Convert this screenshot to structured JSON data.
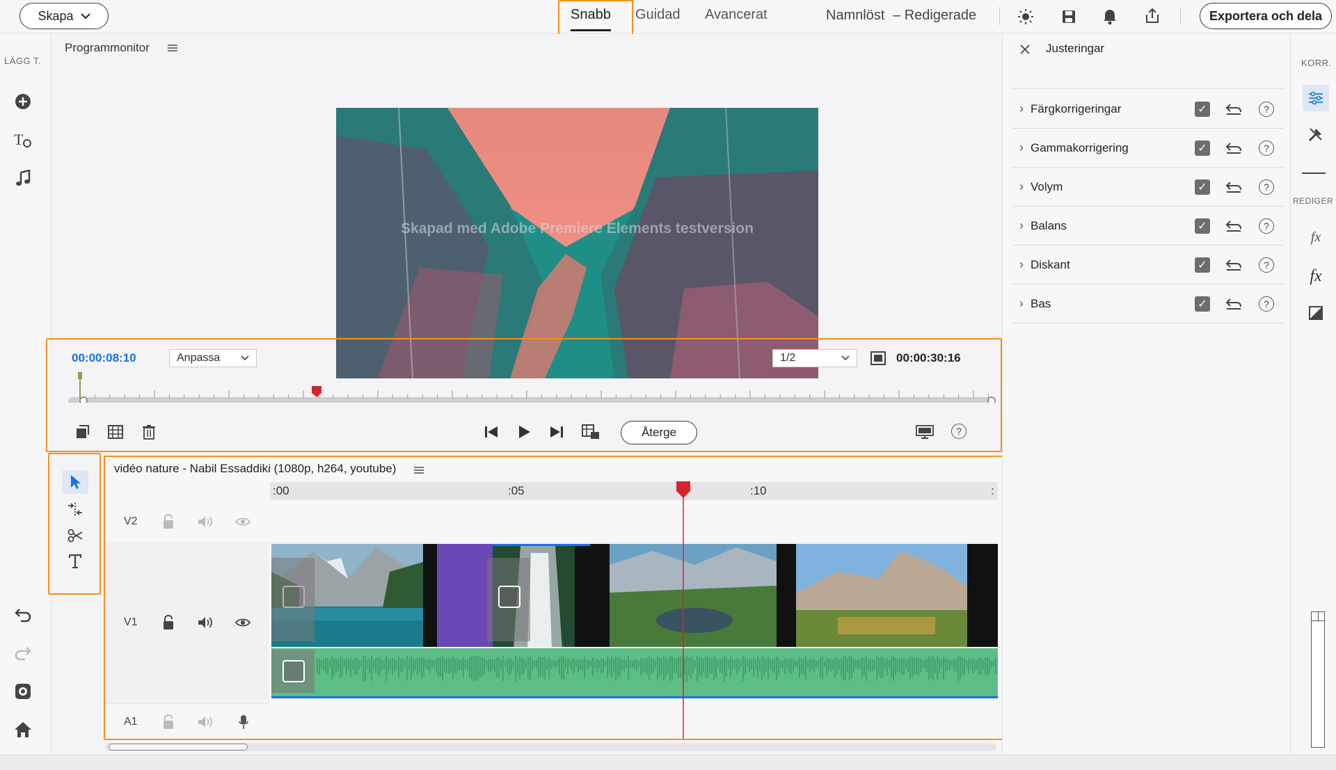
{
  "topbar": {
    "create_label": "Skapa",
    "modes": [
      "Snabb",
      "Guidad",
      "Avancerat"
    ],
    "active_mode": "Snabb",
    "project_name": "Namnlöst",
    "project_status": "– Redigerade",
    "export_label": "Exportera och dela",
    "icons": [
      "brightness-icon",
      "save-icon",
      "bell-icon",
      "share-icon"
    ]
  },
  "leftbar": {
    "add_label": "LÄGG T.",
    "tools": [
      "add-media-icon",
      "title-icon",
      "music-icon"
    ],
    "bottom": [
      "undo-icon",
      "redo-icon",
      "organizer-icon",
      "home-icon"
    ]
  },
  "monitor": {
    "title": "Programmonitor",
    "watermark": "Skapad med Adobe Premiere Elements testversion",
    "current_time": "00:00:08:10",
    "fit_option": "Anpassa",
    "resolution": "1/2",
    "duration": "00:00:30:16",
    "render_label": "Återge",
    "accent_time_color": "#1473e6"
  },
  "timeline": {
    "clip_name": "vidéo nature - Nabil Essaddiki (1080p, h264, youtube)",
    "ruler": [
      ":00",
      ":05",
      ":10",
      ":"
    ],
    "tracks": [
      {
        "name": "V2"
      },
      {
        "name": "V1"
      },
      {
        "name": "A1"
      }
    ],
    "playhead_color": "#d8232a",
    "audio_color": "#5dbd86",
    "transition_color": "#6a48b5"
  },
  "adjustments": {
    "title": "Justeringar",
    "items": [
      {
        "label": "Färgkorrigeringar"
      },
      {
        "label": "Gammakorrigering"
      },
      {
        "label": "Volym"
      },
      {
        "label": "Balans"
      },
      {
        "label": "Diskant"
      },
      {
        "label": "Bas"
      }
    ]
  },
  "farright": {
    "korr_label": "KORR.",
    "redigera_label": "REDIGER"
  },
  "highlight_color": "#f5901e"
}
